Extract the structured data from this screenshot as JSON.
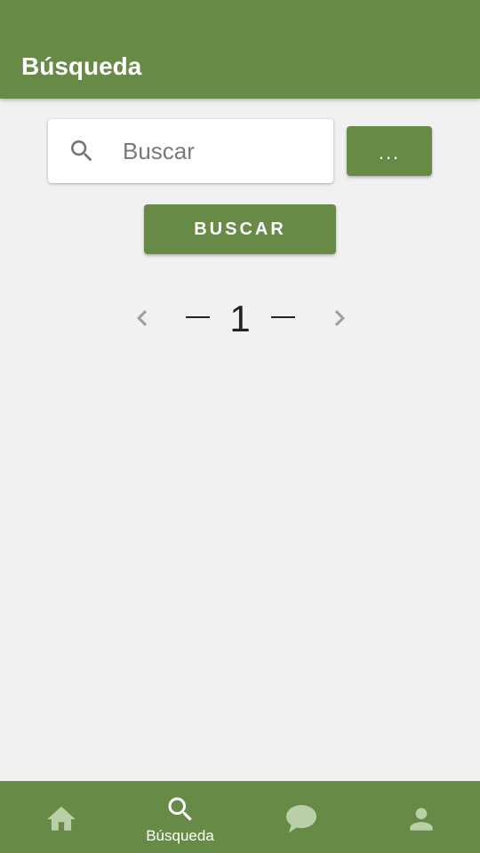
{
  "app_bar": {
    "title": "Búsqueda"
  },
  "search": {
    "placeholder": "Buscar",
    "value": "",
    "icon": "search-icon"
  },
  "more_button": {
    "label": "..."
  },
  "search_button": {
    "label": "BUSCAR"
  },
  "pager": {
    "current_page": "1",
    "prev_icon": "chevron-left-icon",
    "next_icon": "chevron-right-icon"
  },
  "bottom_nav": {
    "items": [
      {
        "icon": "home-icon",
        "label": "",
        "active": false
      },
      {
        "icon": "search-icon",
        "label": "Búsqueda",
        "active": true
      },
      {
        "icon": "chat-icon",
        "label": "",
        "active": false
      },
      {
        "icon": "person-icon",
        "label": "",
        "active": false
      }
    ]
  },
  "colors": {
    "primary": "#678b47",
    "background": "#f1f1f1",
    "inactive_icon": "#b9cfa8",
    "active_icon": "#ffffff"
  }
}
